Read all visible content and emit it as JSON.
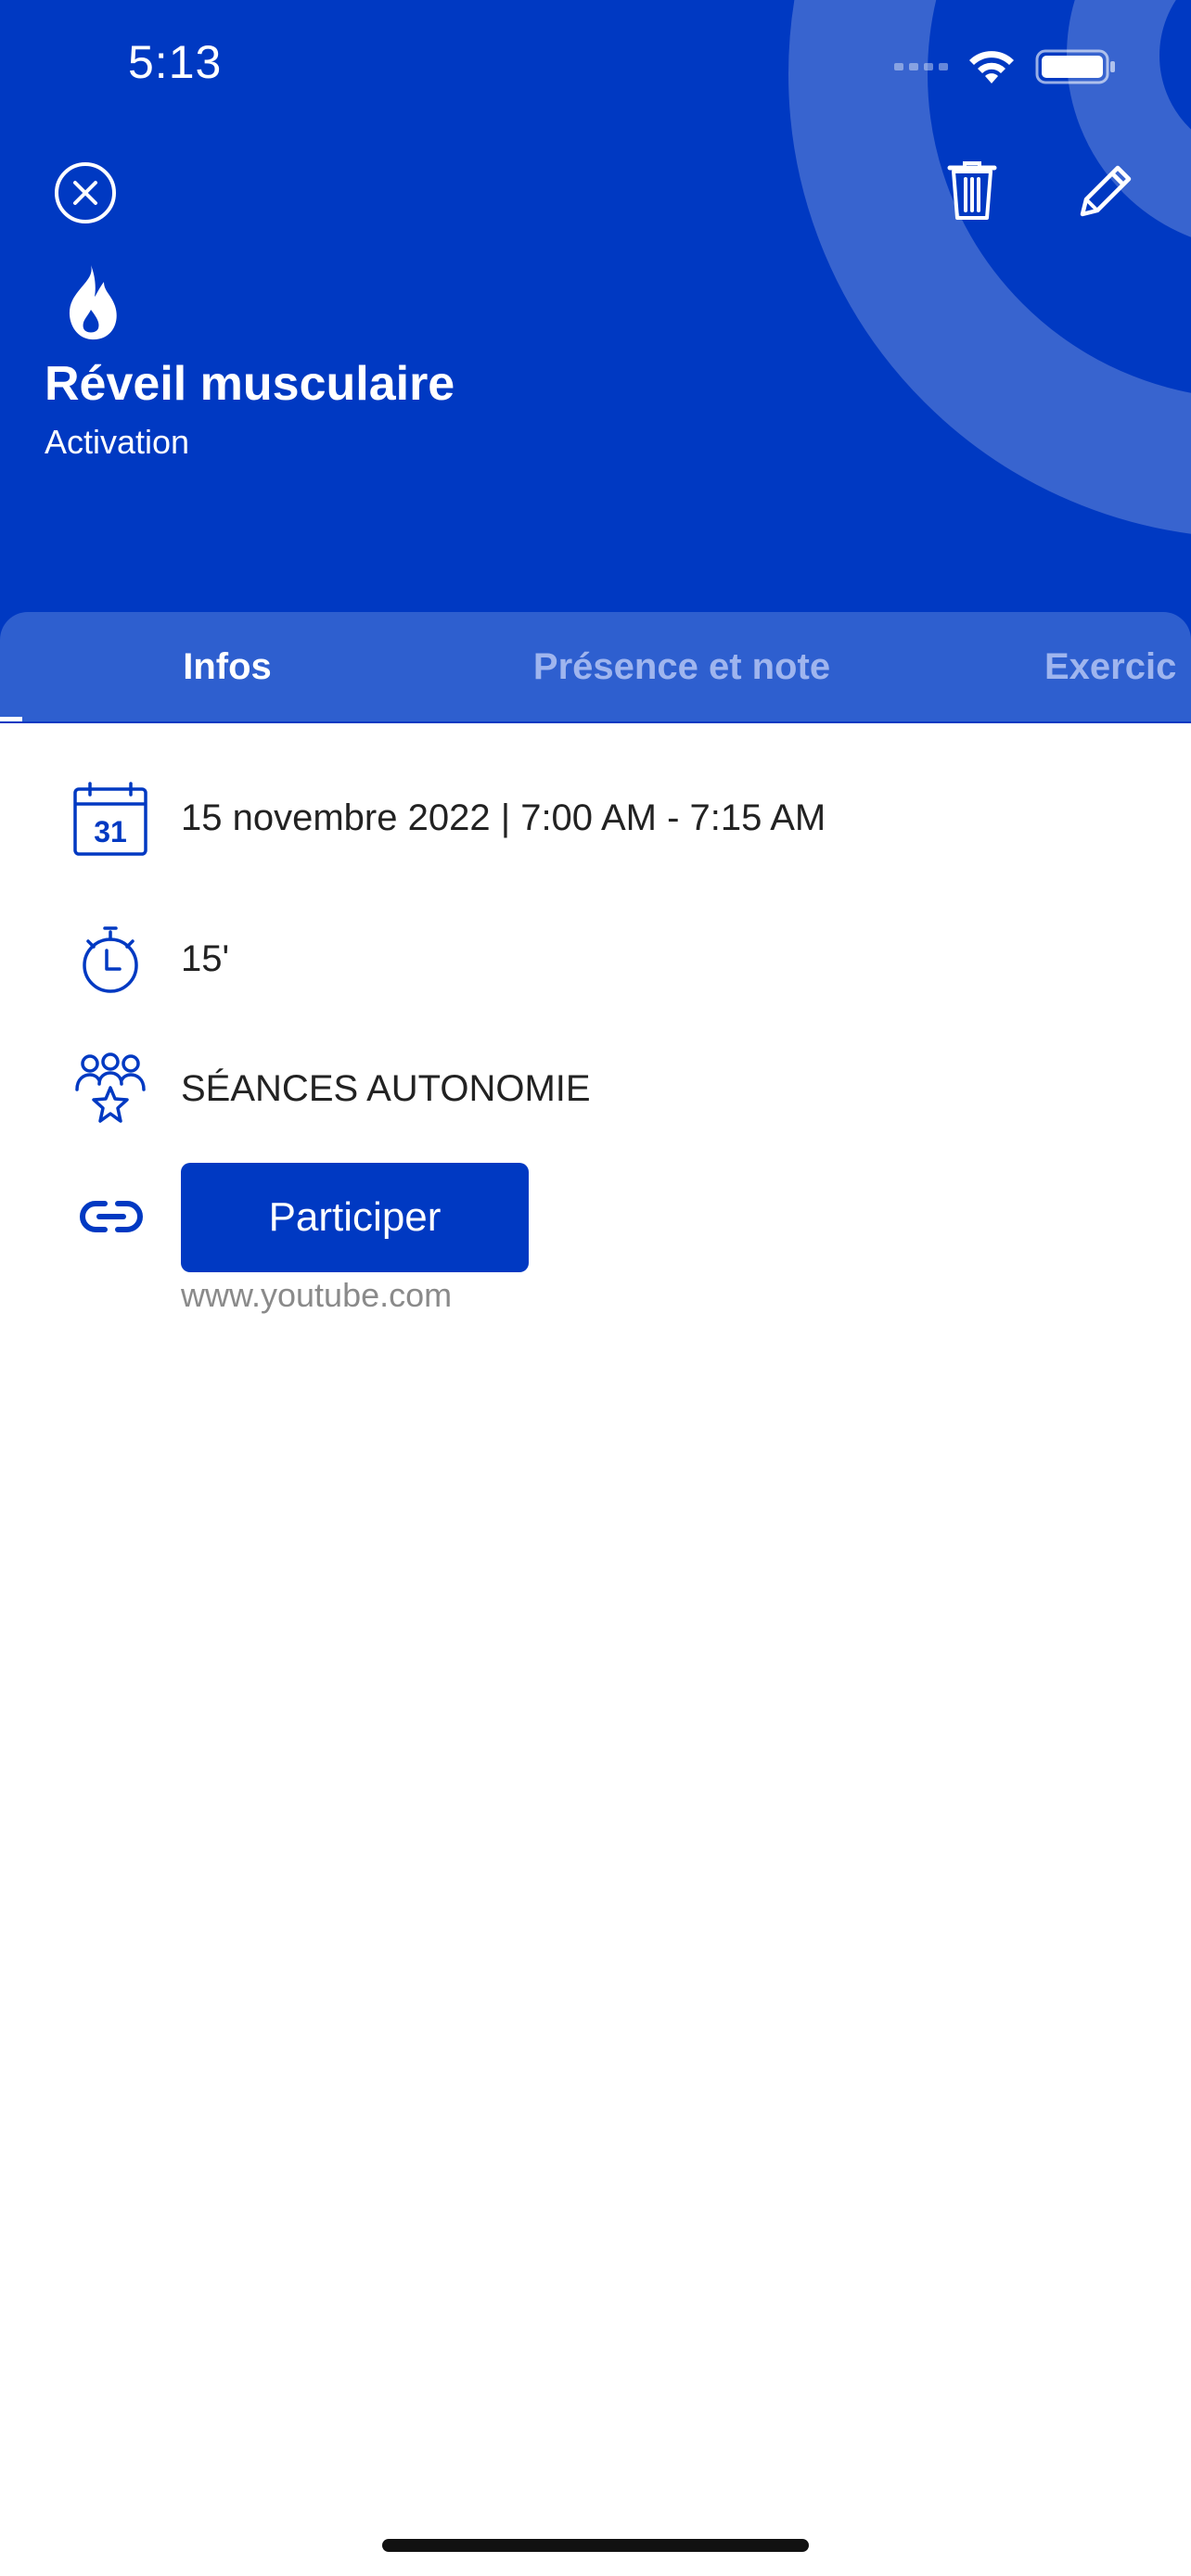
{
  "status_bar": {
    "time": "5:13"
  },
  "header": {
    "title": "Réveil musculaire",
    "subtitle": "Activation",
    "background_color": "#0039c2",
    "icons": {
      "close": "close-circle-icon",
      "delete": "trash-icon",
      "edit": "pencil-icon",
      "category": "flame-icon"
    }
  },
  "tabs": [
    {
      "label": "Infos",
      "active": true
    },
    {
      "label": "Présence et note",
      "active": false
    },
    {
      "label": "Exercic",
      "active": false
    }
  ],
  "info": {
    "date_icon_day": "31",
    "date": "15 novembre 2022 | 7:00 AM - 7:15 AM",
    "duration": "15'",
    "group": "SÉANCES AUTONOMIE",
    "link_button": "Participer",
    "link_url": "www.youtube.com"
  },
  "colors": {
    "accent": "#0039c2",
    "tab_bar": "#2e5fcf",
    "inactive_tab_text": "#9fb5ee"
  }
}
